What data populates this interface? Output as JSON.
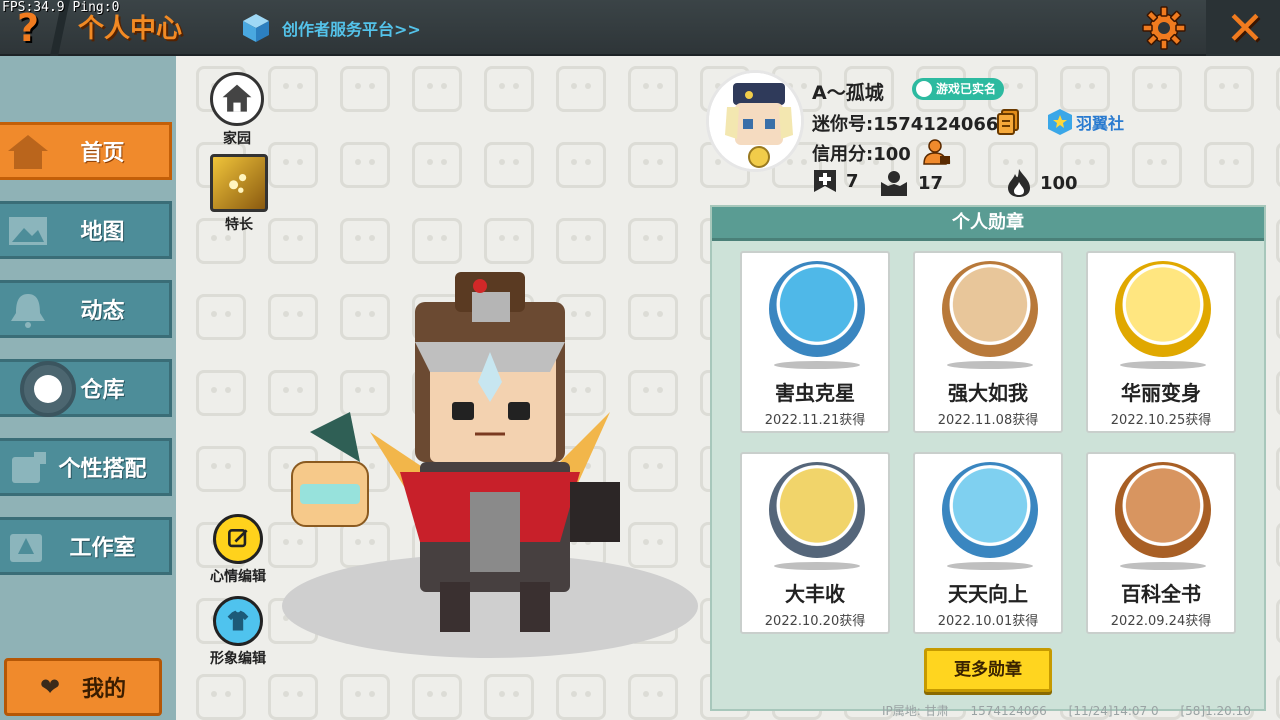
{
  "overlay": {
    "fps_text": "FPS:34.9  Ping:0"
  },
  "header": {
    "help_label": "?",
    "title": "个人中心",
    "creator_link": "创作者服务平台>>",
    "close_label": "✕"
  },
  "sidebar": {
    "items": [
      {
        "label": "首页",
        "icon": "house-icon",
        "active": true
      },
      {
        "label": "地图",
        "icon": "map-icon",
        "active": false
      },
      {
        "label": "动态",
        "icon": "bell-icon",
        "active": false
      },
      {
        "label": "仓库",
        "icon": "warehouse-icon",
        "active": false
      },
      {
        "label": "个性搭配",
        "icon": "outfit-icon",
        "active": false
      },
      {
        "label": "工作室",
        "icon": "studio-icon",
        "active": false
      }
    ],
    "mine_label": "我的"
  },
  "side_buttons": {
    "home": "家园",
    "talent": "特长",
    "mood": "心情编辑",
    "look": "形象编辑"
  },
  "profile": {
    "nickname": "A～孤城",
    "verified_badge": "游戏已实名",
    "mini_id": "迷你号:1574124066",
    "club": "羽翼社",
    "credit": "信用分:100",
    "stats": [
      {
        "icon": "plus-badge-icon",
        "value": "7"
      },
      {
        "icon": "followers-icon",
        "value": "17"
      },
      {
        "icon": "flame-icon",
        "value": "100"
      }
    ]
  },
  "badges": {
    "header": "个人勋章",
    "items": [
      {
        "name": "害虫克星",
        "date": "2022.11.21获得",
        "color": "#4fb8e8",
        "rim": "#3a86c0"
      },
      {
        "name": "强大如我",
        "date": "2022.11.08获得",
        "color": "#e8c69a",
        "rim": "#b8793a"
      },
      {
        "name": "华丽变身",
        "date": "2022.10.25获得",
        "color": "#ffe680",
        "rim": "#e0a800"
      },
      {
        "name": "大丰收",
        "date": "2022.10.20获得",
        "color": "#f1d46a",
        "rim": "#55667a"
      },
      {
        "name": "天天向上",
        "date": "2022.10.01获得",
        "color": "#7fd0f0",
        "rim": "#3a86c0"
      },
      {
        "name": "百科全书",
        "date": "2022.09.24获得",
        "color": "#d89560",
        "rim": "#a85f25"
      }
    ],
    "more_label": "更多勋章"
  },
  "footer": {
    "ip": "IP属地: 甘肃",
    "uid": "1574124066",
    "time": "[11/24]14:07 0",
    "version": "[58]1.20.10"
  }
}
